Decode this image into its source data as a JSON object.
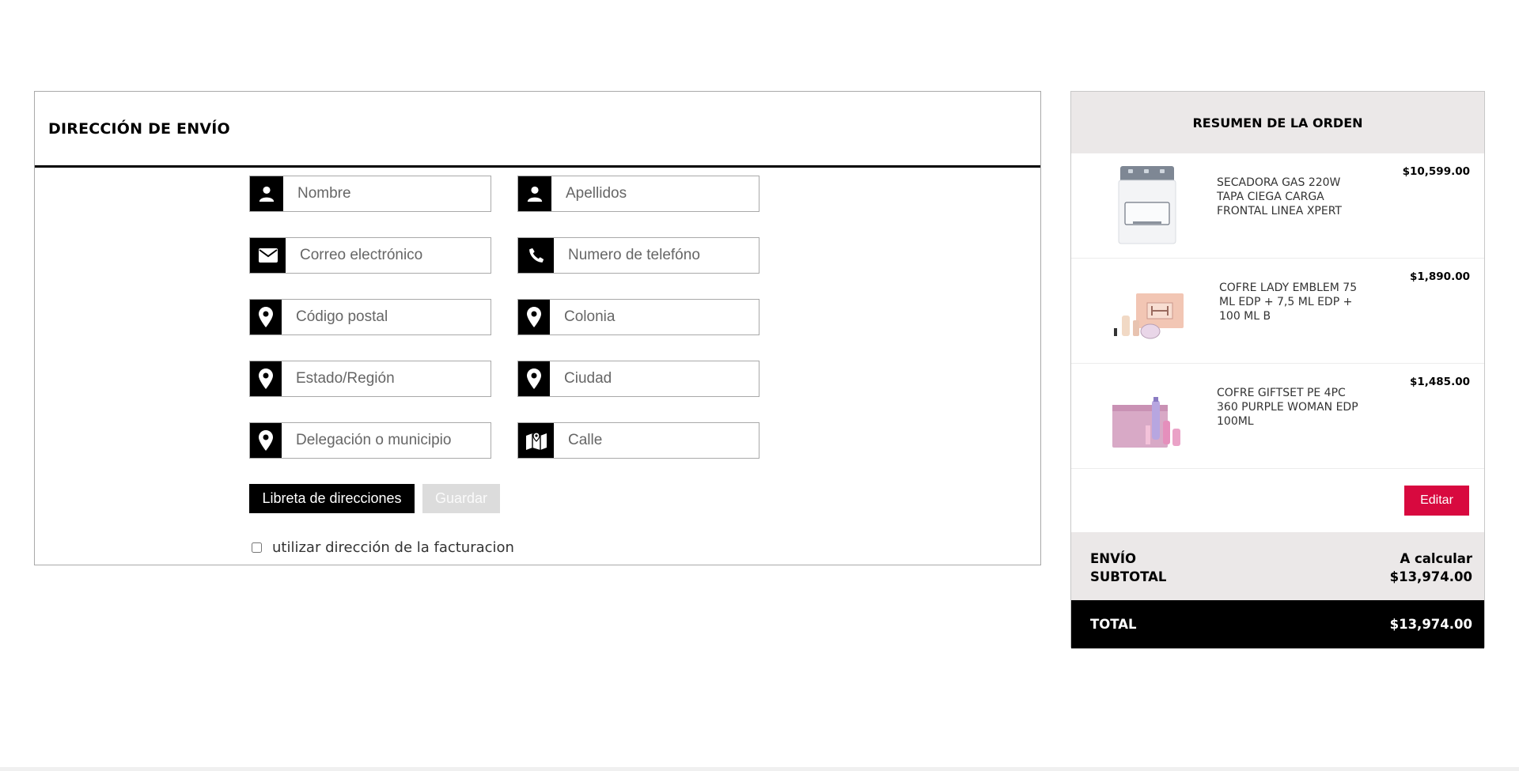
{
  "shipping": {
    "title": "DIRECCIÓN DE ENVÍO",
    "fields": {
      "nombre": {
        "placeholder": "Nombre",
        "icon": "user-icon"
      },
      "apellidos": {
        "placeholder": "Apellidos",
        "icon": "user-icon"
      },
      "correo": {
        "placeholder": "Correo electrónico",
        "icon": "envelope-icon"
      },
      "telefono": {
        "placeholder": "Numero de telefóno",
        "icon": "phone-icon"
      },
      "codigo_postal": {
        "placeholder": "Código postal",
        "icon": "map-pin-icon"
      },
      "colonia": {
        "placeholder": "Colonia",
        "icon": "map-pin-icon"
      },
      "estado": {
        "placeholder": "Estado/Región",
        "icon": "map-pin-icon"
      },
      "ciudad": {
        "placeholder": "Ciudad",
        "icon": "map-pin-icon"
      },
      "delegacion": {
        "placeholder": "Delegación o municipio",
        "icon": "map-pin-icon"
      },
      "calle": {
        "placeholder": "Calle",
        "icon": "folded-map-icon"
      }
    },
    "address_book_label": "Libreta de direcciones",
    "save_label": "Guardar",
    "billing_checkbox_label": "utilizar dirección de la facturacion",
    "billing_checked": false
  },
  "summary": {
    "title": "RESUMEN DE LA ORDEN",
    "items": [
      {
        "name": "SECADORA GAS 220W TAPA CIEGA CARGA FRONTAL LINEA XPERT",
        "price": "$10,599.00",
        "image": "dryer-appliance"
      },
      {
        "name": "COFRE LADY EMBLEM 75 ML EDP + 7,5 ML EDP + 100 ML B",
        "price": "$1,890.00",
        "image": "perfume-gift-set"
      },
      {
        "name": "COFRE GIFTSET PE 4PC 360 PURPLE WOMAN EDP 100ML",
        "price": "$1,485.00",
        "image": "perfume-gift-set-purple"
      }
    ],
    "edit_label": "Editar",
    "shipping_label": "ENVÍO",
    "shipping_value": "A calcular",
    "subtotal_label": "SUBTOTAL",
    "subtotal_value": "$13,974.00",
    "total_label": "TOTAL",
    "total_value": "$13,974.00"
  },
  "colors": {
    "accent": "#d8093f",
    "header_bg": "#ebe8e8",
    "icon_bg": "#000000"
  }
}
